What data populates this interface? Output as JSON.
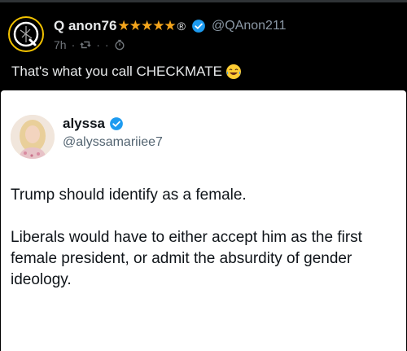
{
  "post": {
    "author": {
      "display_name": "Q anon76",
      "stars": "★★★★★",
      "registered_mark": "®",
      "handle": "@QAnon211",
      "verified": true,
      "avatar_icon": "q-emblem-icon"
    },
    "meta": {
      "time": "7h",
      "separator": "·"
    },
    "text": "That's what you call CHECKMATE"
  },
  "embedded_tweet": {
    "author": {
      "display_name": "alyssa",
      "handle": "@alyssamariiee7",
      "verified": true
    },
    "paragraphs": [
      "Trump should identify as a female.",
      "Liberals would have to either accept him as the first female president, or admit the absurdity of gender ideology."
    ]
  },
  "colors": {
    "background": "#000000",
    "verified_blue": "#1d9bf0",
    "star_gold": "#f4a51c",
    "muted_text": "#71767b",
    "card_background": "#ffffff"
  }
}
